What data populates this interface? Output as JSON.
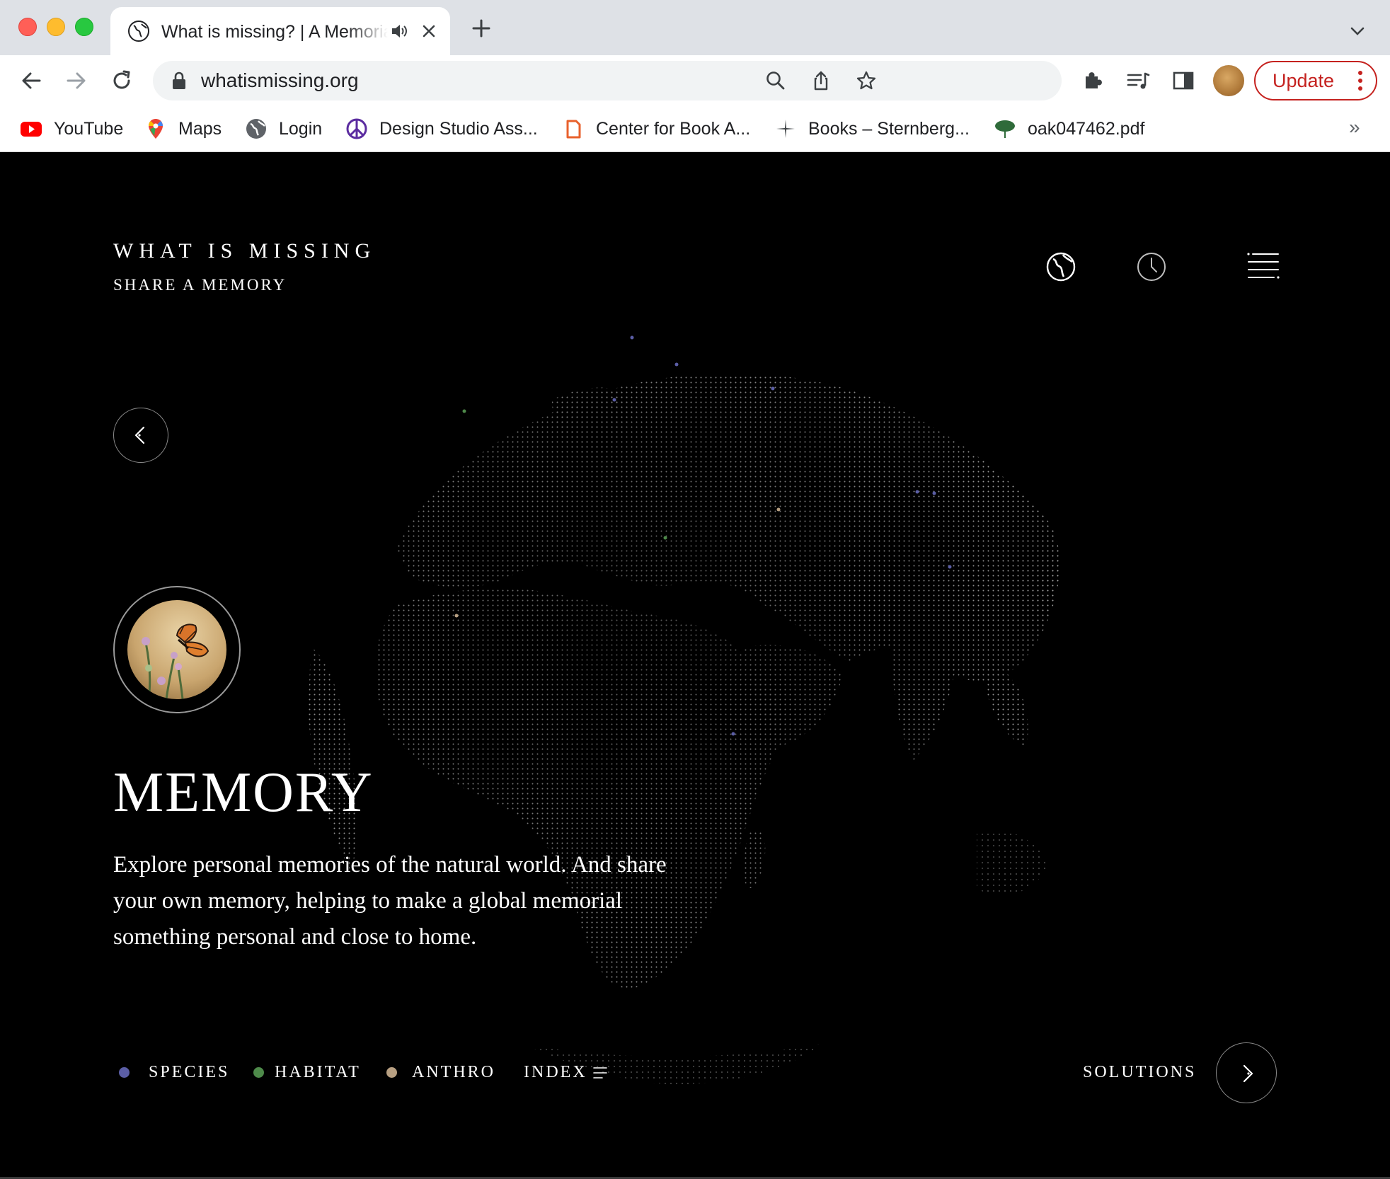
{
  "browser": {
    "tab": {
      "title": "What is missing? | A Memorial",
      "favicon": "globe-icon",
      "audio_icon": "speaker-icon",
      "close_icon": "close-icon"
    },
    "new_tab_icon": "plus-icon",
    "tab_list_icon": "chevron-down-icon",
    "url": "whatismissing.org",
    "update_label": "Update",
    "bookmarks": [
      {
        "label": "YouTube",
        "icon": "youtube-icon"
      },
      {
        "label": "Maps",
        "icon": "maps-icon"
      },
      {
        "label": "Login",
        "icon": "globe-icon"
      },
      {
        "label": "Design Studio Ass...",
        "icon": "peace-icon"
      },
      {
        "label": "Center for Book A...",
        "icon": "bookmark-icon"
      },
      {
        "label": "Books – Sternberg...",
        "icon": "star-burst-icon"
      },
      {
        "label": "oak047462.pdf",
        "icon": "tree-icon"
      }
    ],
    "bookmarks_more": "»",
    "colors": {
      "tabstrip": "#dee1e6",
      "update_red": "#c5221f"
    }
  },
  "site": {
    "logo": "WHAT IS MISSING",
    "share_link": "SHARE A MEMORY",
    "header_icons": [
      "globe-icon",
      "clock-icon",
      "menu-icon"
    ],
    "title": "MEMORY",
    "description": "Explore personal memories of the natural world. And share your own memory, helping to make a global memorial something personal and close to home.",
    "legend": [
      {
        "label": "SPECIES",
        "color": "#5b5ea6"
      },
      {
        "label": "HABITAT",
        "color": "#4e8a4a"
      },
      {
        "label": "ANTHRO",
        "color": "#b8a082"
      }
    ],
    "index_label": "INDEX",
    "solutions_label": "SOLUTIONS",
    "thumbnail": "monarch-butterfly-image"
  }
}
